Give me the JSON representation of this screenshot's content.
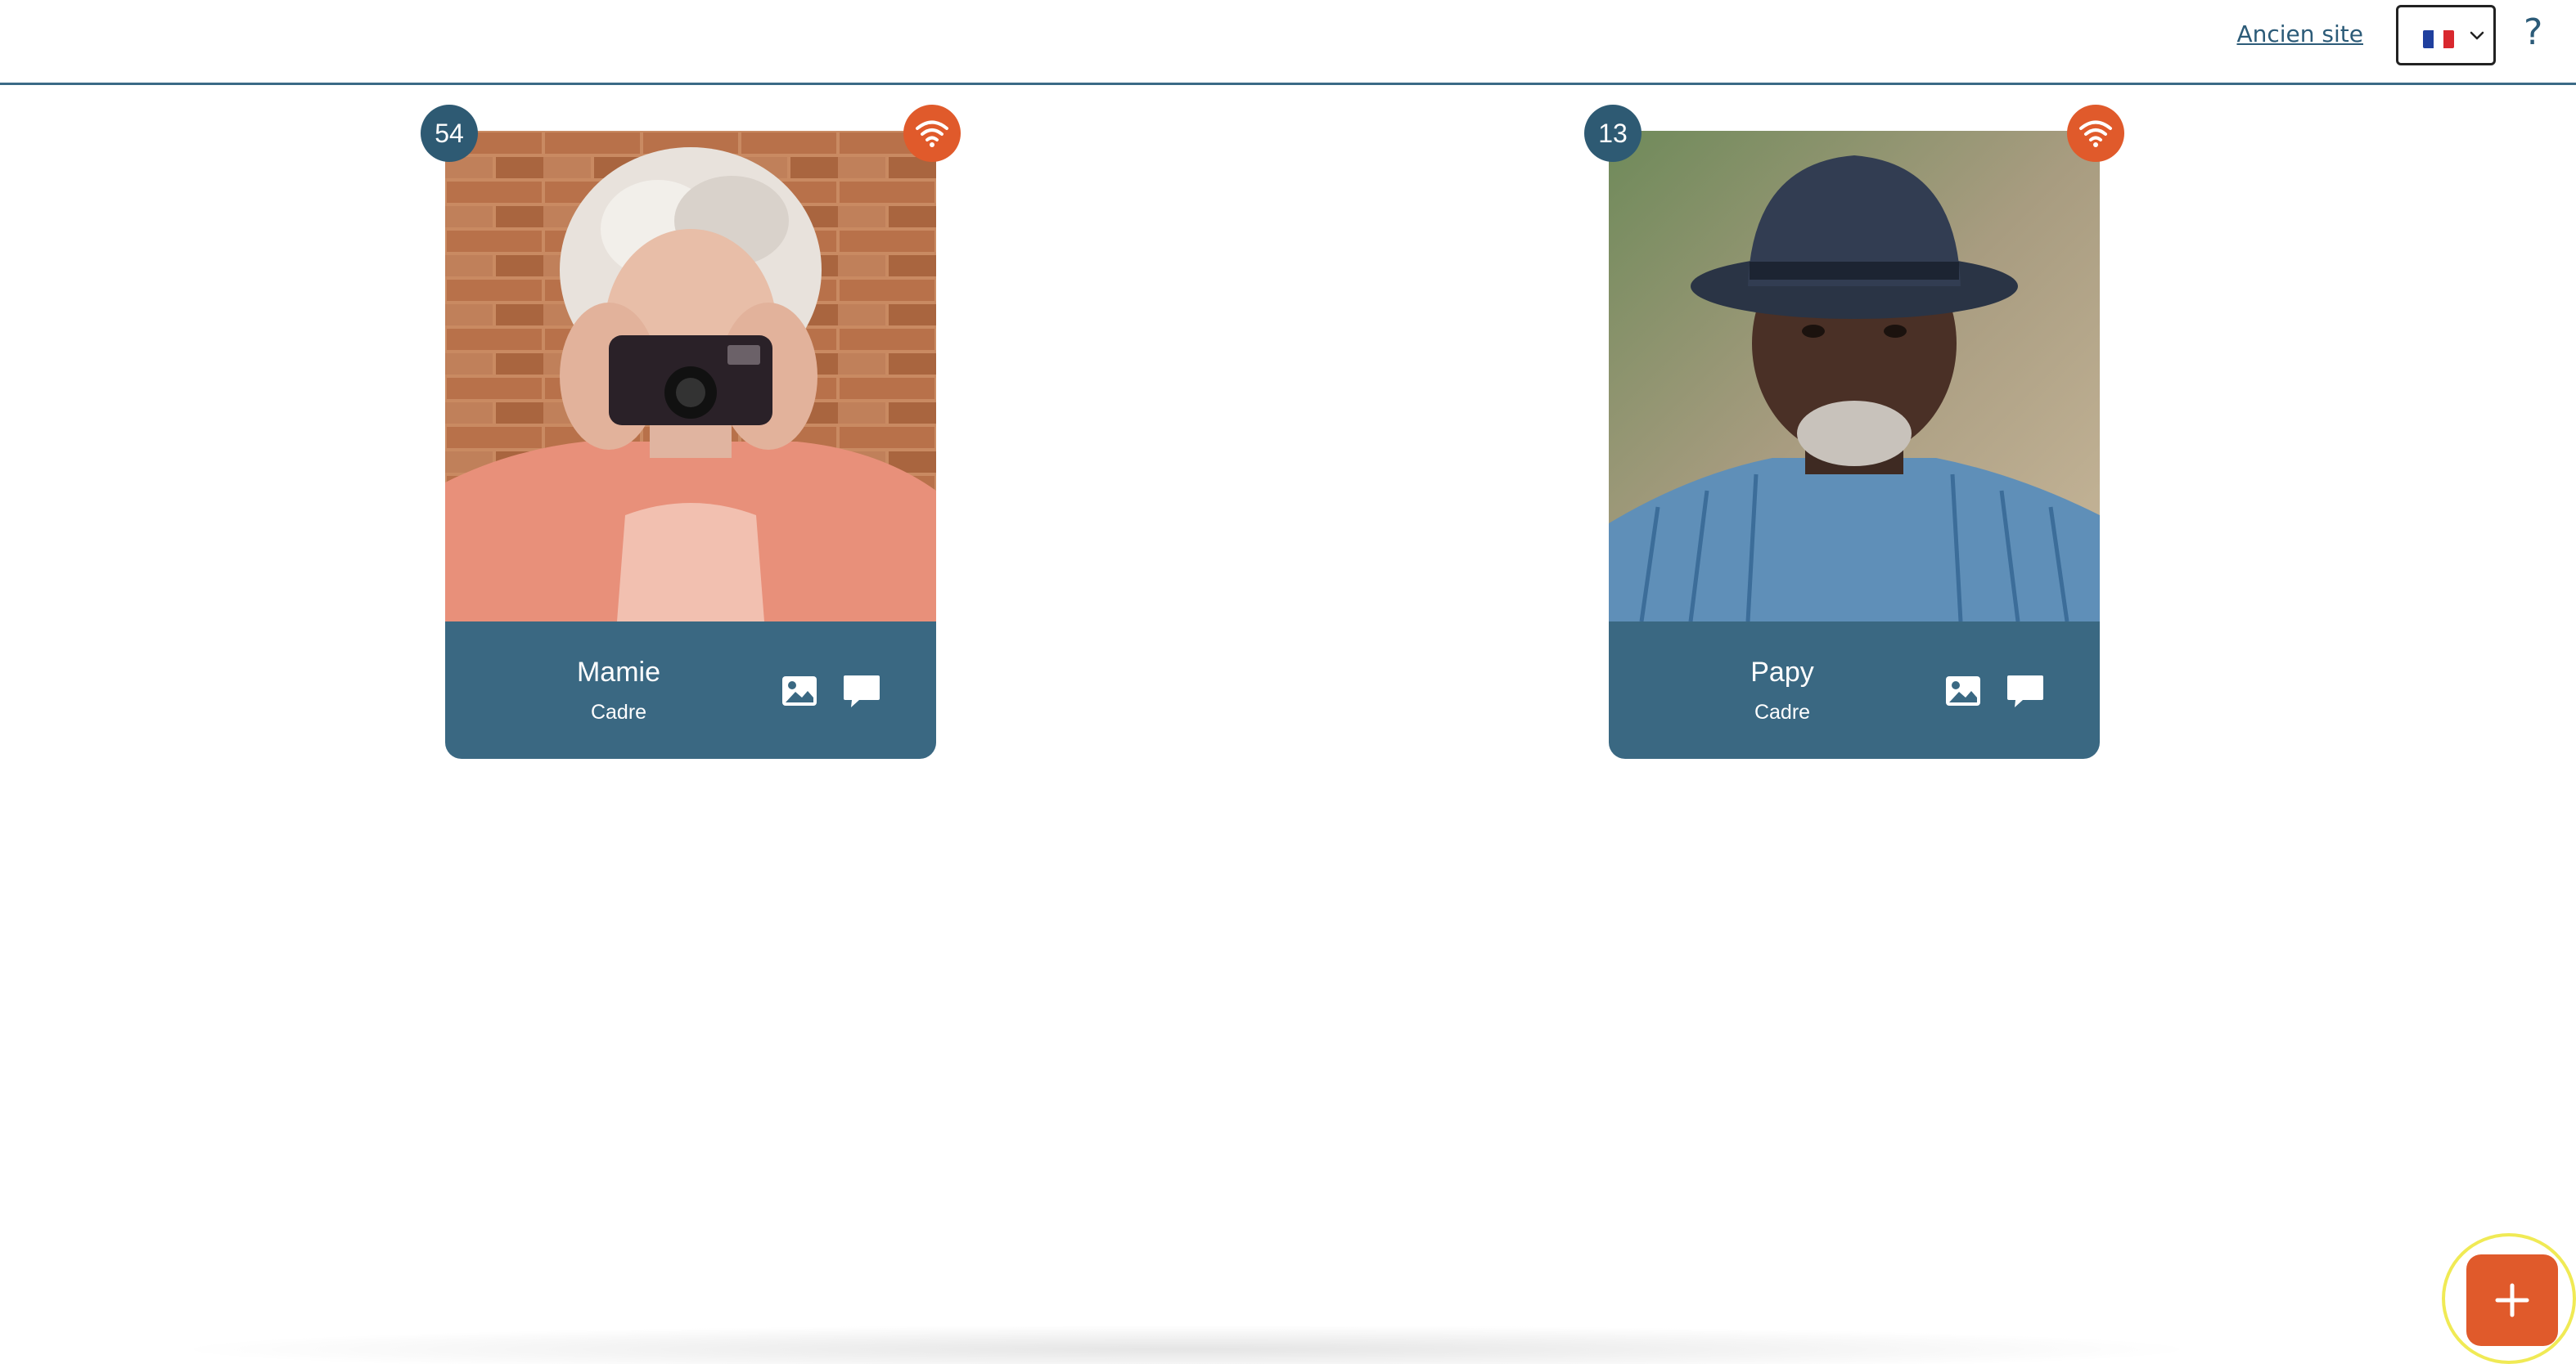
{
  "header": {
    "old_site_link": "Ancien site",
    "language": {
      "selected": "fr",
      "flag_colors": [
        "#1f3f9e",
        "#ffffff",
        "#d8282e"
      ]
    },
    "help_label": "?"
  },
  "cards": [
    {
      "name": "Mamie",
      "role": "Cadre",
      "count": "54",
      "status_icon": "wifi-icon"
    },
    {
      "name": "Papy",
      "role": "Cadre",
      "count": "13",
      "status_icon": "wifi-icon"
    }
  ],
  "fab": {
    "icon": "plus-icon"
  },
  "colors": {
    "accent": "#e05a2b",
    "primary": "#3a6882",
    "badge": "#2e5a73",
    "focus_ring": "#f0ea55"
  }
}
